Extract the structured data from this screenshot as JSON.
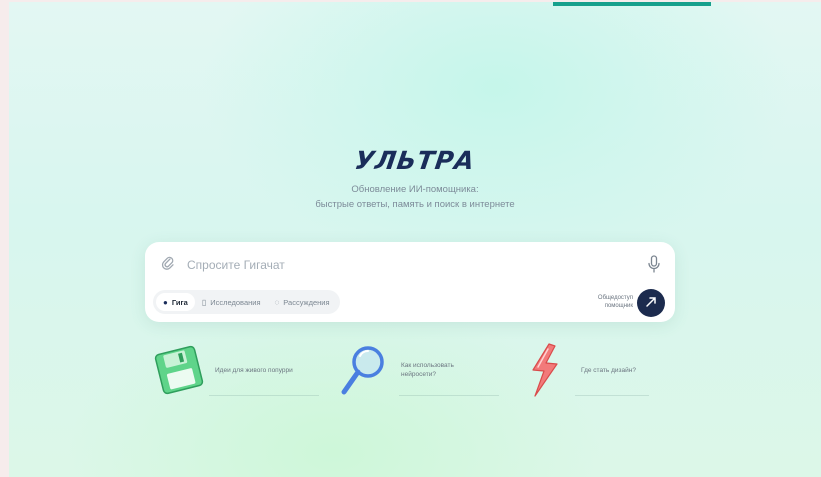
{
  "brand": {
    "logo_text": "УЛЬТРА"
  },
  "subtitle": {
    "line1": "Обновление ИИ-помощника:",
    "line2": "быстрые ответы, память и поиск в интернете"
  },
  "prompt": {
    "placeholder": "Спросите Гигачат",
    "attach_icon": "paperclip-icon",
    "mic_icon": "microphone-icon"
  },
  "modes": [
    {
      "label": "Гига",
      "icon": "giga-icon",
      "active": true
    },
    {
      "label": "Исследования",
      "icon": "document-icon",
      "active": false
    },
    {
      "label": "Рассуждения",
      "icon": "lightbulb-icon",
      "active": false
    }
  ],
  "general": {
    "line1": "Общедоступ",
    "line2": "помощник"
  },
  "send": {
    "icon": "send-icon"
  },
  "suggestions": [
    {
      "text": "Идеи для живого попурри",
      "icon": "floppy-disk-icon",
      "color": "#4ec77a"
    },
    {
      "text": "Как использовать нейросети?",
      "icon": "magnifier-icon",
      "color": "#4a7fe0"
    },
    {
      "text": "Где стать дизайн?",
      "icon": "lightning-icon",
      "color": "#f26b6b"
    }
  ],
  "colors": {
    "accent": "#17a08c",
    "brand": "#1a2d5a",
    "send": "#1c2b4e"
  }
}
